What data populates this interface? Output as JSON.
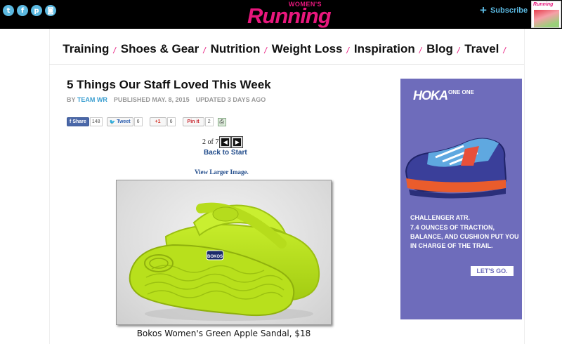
{
  "header": {
    "social": [
      {
        "name": "twitter",
        "glyph": "t"
      },
      {
        "name": "facebook",
        "glyph": "f"
      },
      {
        "name": "pinterest",
        "glyph": "p"
      },
      {
        "name": "instagram",
        "glyph": "◙"
      }
    ],
    "logo_small": "WOMEN'S",
    "logo_big": "Running",
    "subscribe_label": "Subscribe",
    "subscribe_icon": "+",
    "magazine_title": "Running",
    "accent_color": "#e8177d",
    "link_color": "#5bb8e0"
  },
  "nav": {
    "items": [
      "Training",
      "Shoes & Gear",
      "Nutrition",
      "Weight Loss",
      "Inspiration",
      "Blog",
      "Travel"
    ],
    "separator": "/"
  },
  "article": {
    "title": "5 Things Our Staff Loved This Week",
    "byline_prefix": "BY",
    "author": "TEAM WR",
    "published": "PUBLISHED MAY. 8, 2015",
    "updated": "UPDATED 3 DAYS AGO",
    "share": {
      "facebook_label": "Share",
      "facebook_count": "148",
      "twitter_label": "Tweet",
      "twitter_count": "6",
      "gplus_label": "+1",
      "gplus_count": "6",
      "pinterest_label": "Pin it",
      "pinterest_count": "2"
    },
    "pager": {
      "text": "2 of 7",
      "prev_glyph": "◀",
      "next_glyph": "▶",
      "back_to_start": "Back to Start"
    },
    "view_larger": "View Larger Image.",
    "caption": "Bokos Women's Green Apple Sandal, $18"
  },
  "ad": {
    "brand": "HOKA",
    "brand_suffix": "ONE ONE",
    "model": "CHALLENGER ATR.",
    "copy": "7.4 OUNCES OF TRACTION, BALANCE, AND CUSHION PUT YOU IN CHARGE OF THE TRAIL.",
    "cta": "LET'S GO.",
    "bg_color": "#6e6cbb"
  }
}
